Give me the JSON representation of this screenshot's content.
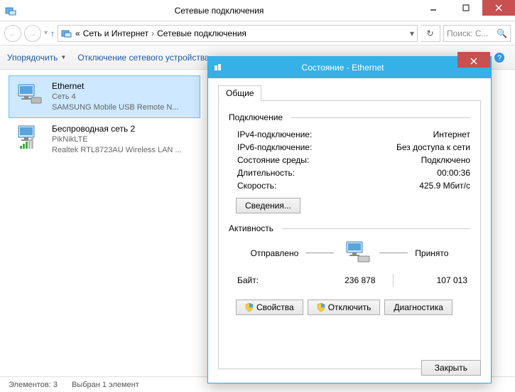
{
  "window": {
    "title": "Сетевые подключения"
  },
  "breadcrumb": {
    "prefix": "«",
    "part1": "Сеть и Интернет",
    "part2": "Сетевые подключения"
  },
  "search": {
    "placeholder": "Поиск: С..."
  },
  "cmdbar": {
    "organize": "Упорядочить",
    "disable": "Отключение сетевого устройства"
  },
  "connections": [
    {
      "title": "Ethernet",
      "sub1": "Сеть 4",
      "sub2": "SAMSUNG Mobile USB Remote N..."
    },
    {
      "title": "Беспроводная сеть 2",
      "sub1": "PikNikLTE",
      "sub2": "Realtek RTL8723AU Wireless LAN ..."
    }
  ],
  "statusbar": {
    "count": "Элементов: 3",
    "selected": "Выбран 1 элемент"
  },
  "dialog": {
    "title": "Состояние - Ethernet",
    "tab_general": "Общие",
    "group_conn": "Подключение",
    "ipv4_k": "IPv4-подключение:",
    "ipv4_v": "Интернет",
    "ipv6_k": "IPv6-подключение:",
    "ipv6_v": "Без доступа к сети",
    "media_k": "Состояние среды:",
    "media_v": "Подключено",
    "dur_k": "Длительность:",
    "dur_v": "00:00:36",
    "speed_k": "Скорость:",
    "speed_v": "425.9 Мбит/с",
    "details_btn": "Сведения...",
    "group_act": "Активность",
    "sent": "Отправлено",
    "recv": "Принято",
    "bytes_label": "Байт:",
    "bytes_sent": "236 878",
    "bytes_recv": "107 013",
    "props_btn": "Свойства",
    "disable_btn": "Отключить",
    "diag_btn": "Диагностика",
    "close_btn": "Закрыть"
  }
}
